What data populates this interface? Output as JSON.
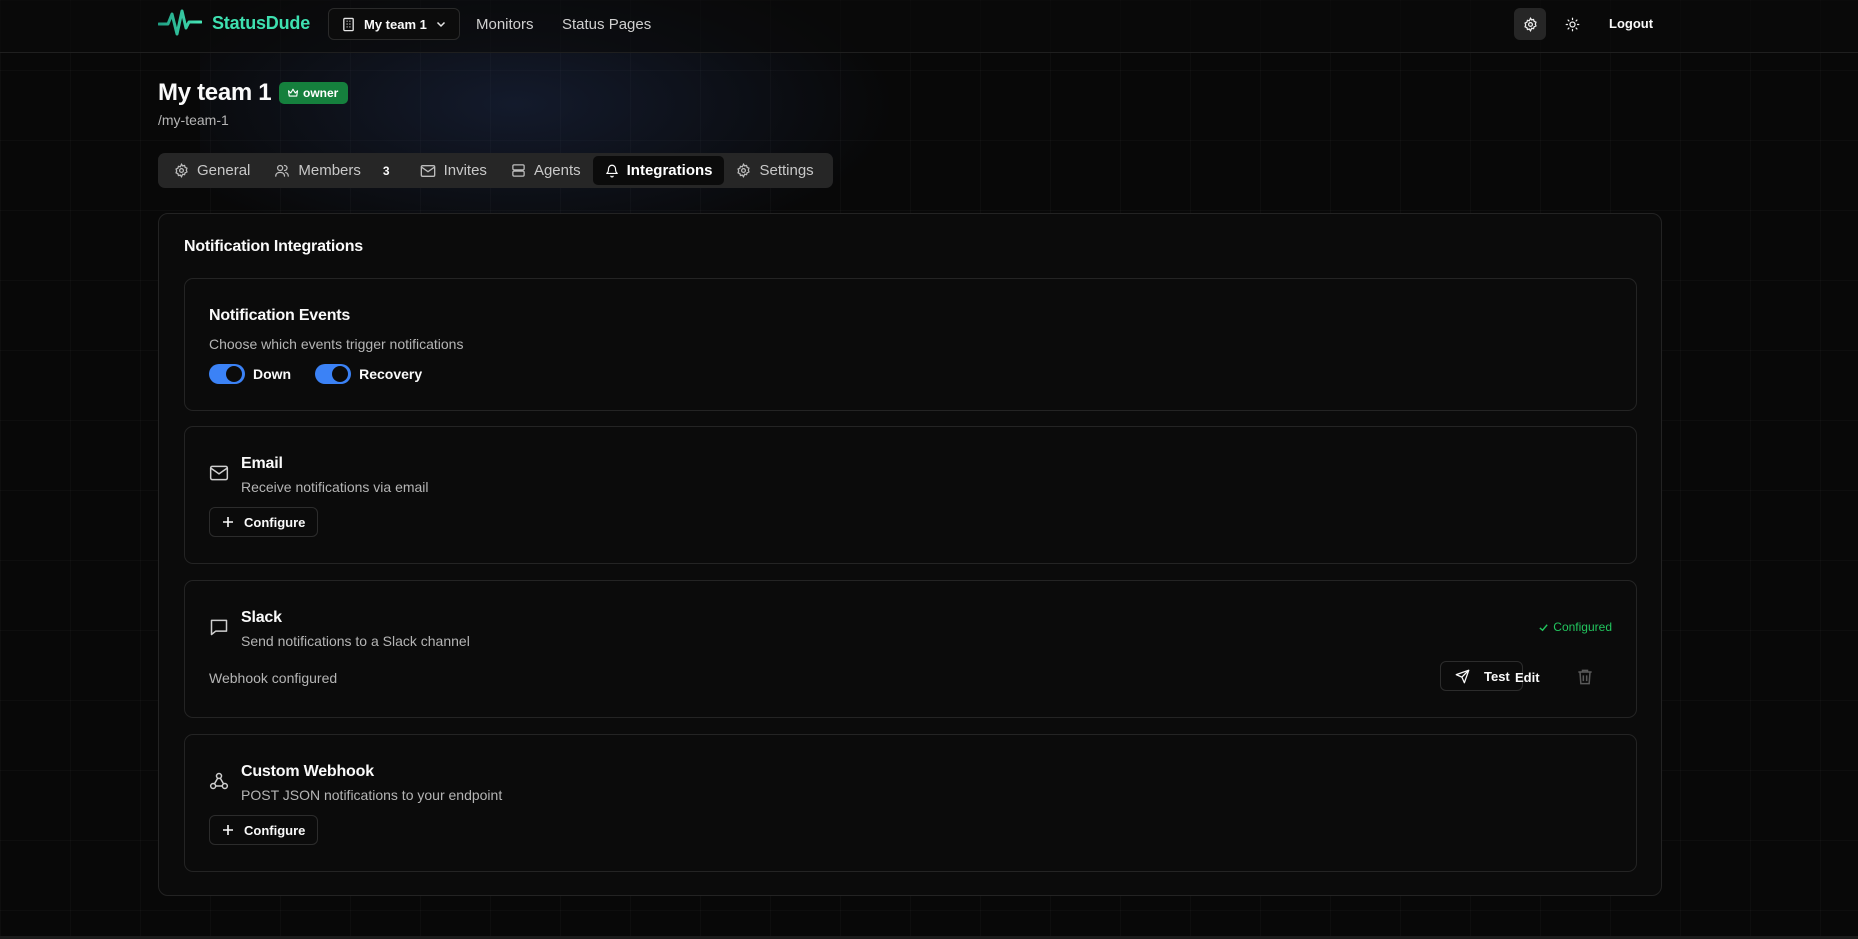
{
  "header": {
    "brand": "StatusDude",
    "team_switcher": "My team 1",
    "nav": {
      "monitors": "Monitors",
      "status_pages": "Status Pages"
    },
    "logout": "Logout"
  },
  "page": {
    "title": "My team 1",
    "role_badge": "owner",
    "slug": "/my-team-1"
  },
  "tabs": {
    "general": "General",
    "members": "Members",
    "members_count": "3",
    "invites": "Invites",
    "agents": "Agents",
    "integrations": "Integrations",
    "settings": "Settings",
    "active": "Integrations"
  },
  "integrations": {
    "title": "Notification Integrations",
    "events": {
      "title": "Notification Events",
      "description": "Choose which events trigger notifications",
      "toggles": {
        "down": "Down",
        "recovery": "Recovery"
      }
    },
    "email": {
      "title": "Email",
      "description": "Receive notifications via email",
      "configure": "Configure"
    },
    "slack": {
      "title": "Slack",
      "description": "Send notifications to a Slack channel",
      "status": "Configured",
      "webhook_text": "Webhook configured",
      "test": "Test",
      "edit": "Edit"
    },
    "webhook": {
      "title": "Custom Webhook",
      "description": "POST JSON notifications to your endpoint",
      "configure": "Configure"
    }
  },
  "colors": {
    "brand": "#3ee0b0",
    "badge": "#15803d",
    "toggle": "#3b82f6",
    "success": "#22c55e"
  }
}
